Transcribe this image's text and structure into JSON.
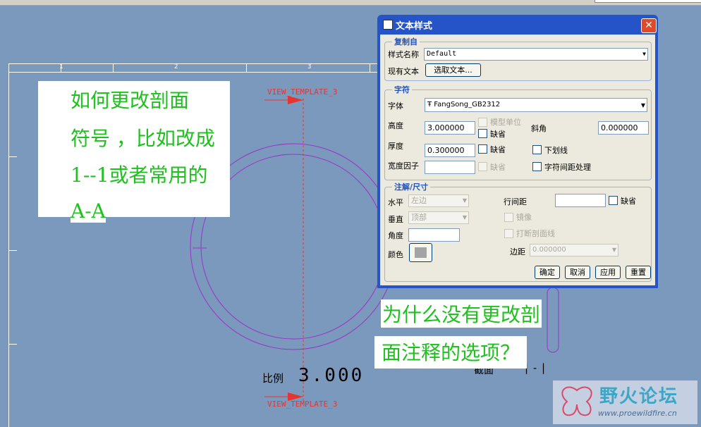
{
  "drawing": {
    "ruler_numbers": [
      "1",
      "2",
      "3"
    ],
    "view_label_top": "VIEW_TEMPLATE_3",
    "view_label_bottom": "VIEW_TEMPLATE_3",
    "scale_label": "比例",
    "scale_value": "3.000",
    "section_label": "截面",
    "section_value": "|-|"
  },
  "annotations": {
    "left_lines": [
      "如何更改剖面",
      "符号 ，比如改成",
      "1--1或者常用的",
      "A-A"
    ],
    "right_lines": [
      "为什么没有更改剖",
      "面注释的选项？"
    ]
  },
  "dialog": {
    "title": "文本样式",
    "close_glyph": "✕",
    "copy_from": {
      "group_title": "复制自",
      "style_name_label": "样式名称",
      "style_name_value": "Default",
      "existing_text_label": "现有文本",
      "select_text_button": "选取文本..."
    },
    "character": {
      "group_title": "字符",
      "font_label": "字体",
      "font_value": "FangSong_GB2312",
      "font_glyph": "Ŧ",
      "height_label": "高度",
      "height_value": "3.000000",
      "model_units_label": "模型单位",
      "default_label": "缺省",
      "slant_label": "斜角",
      "slant_value": "0.000000",
      "thickness_label": "厚度",
      "thickness_value": "0.300000",
      "thickness_default_label": "缺省",
      "underline_label": "下划线",
      "width_factor_label": "宽度因子",
      "width_factor_value": "",
      "width_default_label": "缺省",
      "kerning_label": "字符间距处理"
    },
    "note_dim": {
      "group_title": "注解/尺寸",
      "horizontal_label": "水平",
      "horizontal_value": "左边",
      "vertical_label": "垂直",
      "vertical_value": "顶部",
      "angle_label": "角度",
      "angle_value": "",
      "color_label": "颜色",
      "line_spacing_label": "行间距",
      "line_spacing_value": "",
      "line_spacing_default_label": "缺省",
      "mirror_label": "镜像",
      "break_hatch_label": "打断剖面线",
      "margin_label": "边距",
      "margin_value": "0.000000"
    },
    "buttons": {
      "ok": "确定",
      "cancel": "取消",
      "apply": "应用",
      "reset": "重置"
    }
  },
  "watermark": {
    "name": "野火论坛",
    "url": "www.proewildfire.cn"
  },
  "colors": {
    "background": "#7b98bd",
    "note_text": "#1fc11f",
    "view_label": "#e8342e",
    "circle": "#9a33c7",
    "dialog_title_bar": "#2454c8"
  }
}
